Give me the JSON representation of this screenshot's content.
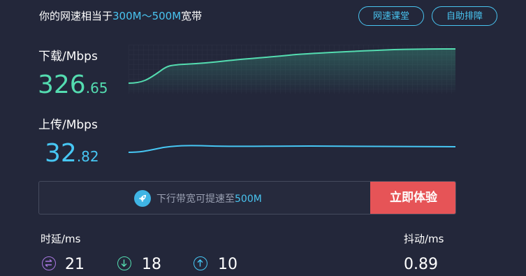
{
  "header": {
    "prefix": "你的网速相当于",
    "range": "300M～500M",
    "suffix": "宽带",
    "buttons": [
      "网速课堂",
      "自助排障"
    ]
  },
  "download": {
    "label": "下载/Mbps",
    "int": "326",
    "dec": ".65"
  },
  "upload": {
    "label": "上传/Mbps",
    "int": "32",
    "dec": ".82"
  },
  "promo": {
    "text_prefix": "下行带宽可提速至",
    "text_highlight": "500M",
    "button": "立即体验"
  },
  "latency": {
    "label": "时延/ms",
    "values": [
      {
        "icon": "bidirectional-icon",
        "value": "21"
      },
      {
        "icon": "download-arrow-icon",
        "value": "18"
      },
      {
        "icon": "upload-arrow-icon",
        "value": "10"
      }
    ]
  },
  "jitter": {
    "label": "抖动/ms",
    "value": "0.89"
  },
  "colors": {
    "background": "#23273a",
    "accent_blue": "#49c4f0",
    "download_green": "#54dcb0",
    "button_red": "#e65457"
  }
}
